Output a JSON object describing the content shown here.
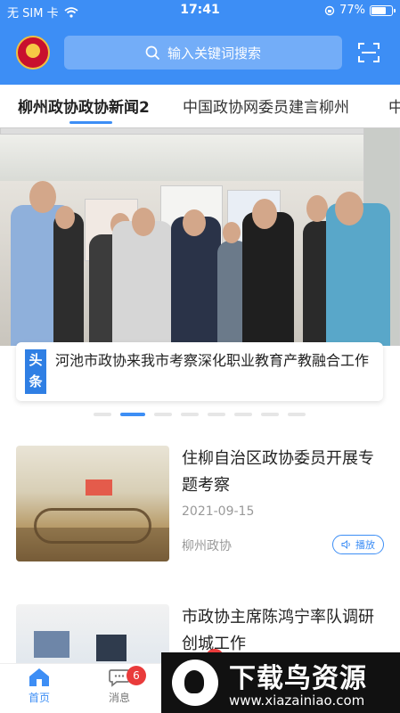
{
  "status_bar": {
    "carrier": "无 SIM 卡",
    "time": "17:41",
    "battery": "77%",
    "battery_level": 0.77
  },
  "header": {
    "search_placeholder": "输入关键词搜索"
  },
  "tabs": [
    {
      "label": "柳州政协政协新闻2",
      "active": true
    },
    {
      "label": "中国政协网委员建言柳州",
      "active": false
    },
    {
      "label": "中",
      "active": false
    }
  ],
  "banner": {
    "badge": "头条",
    "headline": "河池市政协来我市考察深化职业教育产教融合工作",
    "slide_count": 8,
    "active_slide": 2
  },
  "news": [
    {
      "title": "住柳自治区政协委员开展专题考察",
      "date": "2021-09-15",
      "source": "柳州政协",
      "play_label": "播放"
    },
    {
      "title": "市政协主席陈鸿宁率队调研创城工作"
    }
  ],
  "bottom_nav": [
    {
      "label": "首页",
      "active": true
    },
    {
      "label": "消息",
      "active": false,
      "badge": "6"
    }
  ],
  "watermark": {
    "title": "下载鸟资源",
    "url": "www.xiazainiao.com"
  },
  "colors": {
    "primary": "#3d8ef5",
    "badge_red": "#e93b3b"
  }
}
